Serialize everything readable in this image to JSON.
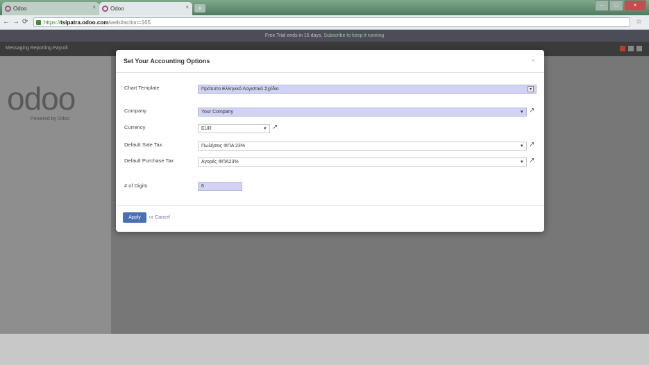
{
  "browser": {
    "tabs": [
      {
        "label": "Odoo",
        "active": false
      },
      {
        "label": "Odoo",
        "active": true
      }
    ],
    "url": {
      "scheme": "https://",
      "host": "tsipatra.odoo.com",
      "path": "/web#action=165"
    }
  },
  "odoo": {
    "notice": "Free Trial ends in 15 days",
    "notice_action": "Subscribe to keep it running",
    "top_menu": "Messaging  Reporting  Payroll",
    "logo": "odoo",
    "powered_by": "Powered by Odoo"
  },
  "dialog": {
    "title": "Set Your Accounting Options",
    "close": "×",
    "fields": [
      {
        "label": "Chart Template",
        "value": "Πρότυπο Ελληνικό Λογιστικό Σχέδιο"
      },
      {
        "label": "Company",
        "value": "Your Company"
      },
      {
        "label": "Currency",
        "value": "EUR"
      },
      {
        "label": "Default Sale Tax",
        "value": "Πωλήσεις ΦΠΑ 23%"
      },
      {
        "label": "Default Purchase Tax",
        "value": "Αγορές ΦΠΑ23%"
      },
      {
        "label": "# of Digits",
        "value": "6"
      }
    ],
    "apply_label": "Apply",
    "or_text": "or",
    "cancel_label": "Cancel"
  },
  "colors": {
    "required_field": "#d2d2f4",
    "apply_button": "#4a6fb5"
  }
}
